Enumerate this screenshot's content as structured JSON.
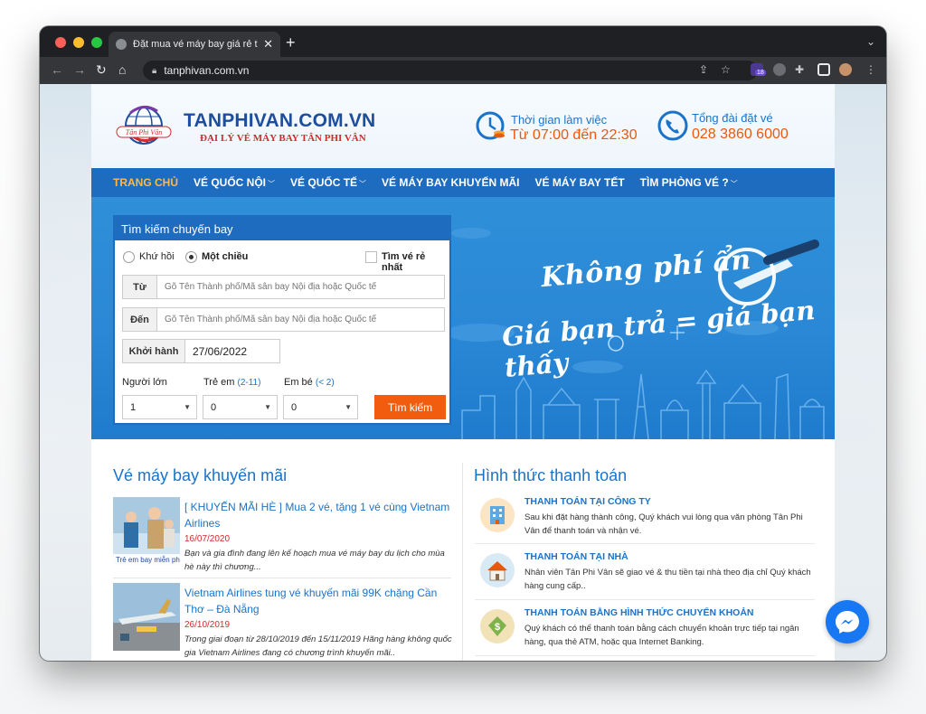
{
  "browser": {
    "tab_title": "Đặt mua vé máy bay giá rẻ trong",
    "url": "tanphivan.com.vn",
    "extension_badge": "18"
  },
  "header": {
    "brand": "TANPHIVAN.COM.VN",
    "tagline": "ĐẠI LÝ VÉ MÁY BAY TÂN PHI VÂN",
    "logo_text": "Tân Phi Vân",
    "hours_label": "Thời gian làm việc",
    "hours_value": "Từ 07:00 đến 22:30",
    "hotline_label": "Tổng đài đặt vé",
    "hotline_value": "028 3860 6000"
  },
  "nav": {
    "items": [
      {
        "label": "TRANG CHỦ",
        "caret": ""
      },
      {
        "label": "VÉ QUỐC NỘI",
        "caret": "﹀"
      },
      {
        "label": "VÉ QUỐC TẾ",
        "caret": "﹀"
      },
      {
        "label": "VÉ MÁY BAY KHUYẾN MÃI",
        "caret": ""
      },
      {
        "label": "VÉ MÁY BAY TẾT",
        "caret": ""
      },
      {
        "label": "TÌM PHÒNG VÉ ?",
        "caret": "﹀"
      }
    ]
  },
  "banner": {
    "slogan_line1": "Không phí ẩn",
    "slogan_line2": "Giá bạn trả = giá bạn thấy"
  },
  "search": {
    "title": "Tìm kiếm chuyến bay",
    "round_trip": "Khứ hồi",
    "one_way": "Một chiều",
    "cheapest": "Tìm vé rẻ nhất",
    "from_label": "Từ",
    "from_placeholder": "Gõ Tên Thành phố/Mã sân bay Nội địa hoặc Quốc tế",
    "to_label": "Đến",
    "to_placeholder": "Gõ Tên Thành phố/Mã sân bay Nội địa hoặc Quốc tế",
    "depart_label": "Khởi hành",
    "depart_value": "27/06/2022",
    "adult_label": "Người lớn",
    "child_label": "Trẻ em",
    "child_hint": "(2-11)",
    "infant_label": "Em bé",
    "infant_hint": "(< 2)",
    "adult_value": "1",
    "child_value": "0",
    "infant_value": "0",
    "submit": "Tìm kiếm"
  },
  "promotions": {
    "title": "Vé máy bay khuyến mãi",
    "items": [
      {
        "title": "[ KHUYẾN MÃI HÈ ] Mua 2 vé, tặng 1 vé cùng Vietnam Airlines",
        "date": "16/07/2020",
        "excerpt": "Bạn và gia đình đang lên kế hoạch mua vé máy bay du lịch cho mùa hè này thì chương...",
        "image_caption": "Trẻ em bay miễn phí"
      },
      {
        "title": "Vietnam Airlines tung vé khuyến mãi 99K chặng Cần Thơ – Đà Nẵng",
        "date": "26/10/2019",
        "excerpt": "Trong giai đoạn từ  28/10/2019 đến 15/11/2019 Hãng hàng không quốc gia Vietnam Airlines đang có chương trình khuyến mãi.."
      }
    ]
  },
  "payment": {
    "title": "Hình thức thanh toán",
    "items": [
      {
        "title": "THANH TOÁN TẠI CÔNG TY",
        "text": "Sau khi đặt hàng thành công, Quý khách vui lòng qua văn phòng Tân Phi Vân để thanh toán và nhận vé."
      },
      {
        "title": "THANH TOÁN TẠI NHÀ",
        "text": "Nhân viên Tân Phi Vân sẽ giao vé & thu tiền tại nhà theo địa chỉ Quý khách hàng cung cấp.."
      },
      {
        "title": "THANH TOÁN BẰNG HÌNH THỨC CHUYỂN KHOẢN",
        "text": "Quý khách có thể thanh toán bằng cách chuyển khoản trực tiếp tại ngân hàng, qua thẻ ATM, hoặc qua Internet Banking."
      }
    ]
  }
}
